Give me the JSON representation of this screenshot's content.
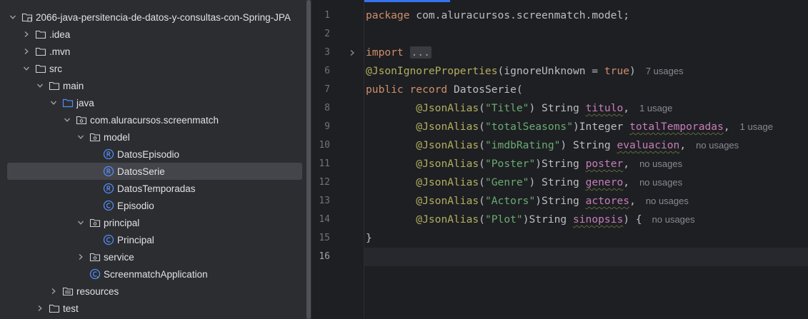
{
  "project_tree": {
    "items": [
      {
        "label": "2066-java-persitencia-de-datos-y-consultas-con-Spring-JPA",
        "icon": "module-folder-icon",
        "expanded": true
      },
      {
        "label": ".idea",
        "icon": "folder-icon",
        "expanded": false
      },
      {
        "label": ".mvn",
        "icon": "folder-icon",
        "expanded": false
      },
      {
        "label": "src",
        "icon": "folder-icon",
        "expanded": true
      },
      {
        "label": "main",
        "icon": "folder-icon",
        "expanded": true
      },
      {
        "label": "java",
        "icon": "source-folder-icon",
        "expanded": true
      },
      {
        "label": "com.aluracursos.screenmatch",
        "icon": "package-icon",
        "expanded": true
      },
      {
        "label": "model",
        "icon": "package-icon",
        "expanded": true
      },
      {
        "label": "DatosEpisodio",
        "icon": "record-icon"
      },
      {
        "label": "DatosSerie",
        "icon": "record-icon",
        "selected": true
      },
      {
        "label": "DatosTemporadas",
        "icon": "record-icon"
      },
      {
        "label": "Episodio",
        "icon": "class-icon"
      },
      {
        "label": "principal",
        "icon": "package-icon",
        "expanded": true
      },
      {
        "label": "Principal",
        "icon": "class-icon"
      },
      {
        "label": "service",
        "icon": "package-icon",
        "expanded": false
      },
      {
        "label": "ScreenmatchApplication",
        "icon": "spring-app-icon"
      },
      {
        "label": "resources",
        "icon": "resources-folder-icon",
        "expanded": false
      },
      {
        "label": "test",
        "icon": "folder-icon",
        "expanded": false
      }
    ]
  },
  "editor": {
    "line_numbers": [
      "1",
      "2",
      "3",
      "6",
      "7",
      "8",
      "9",
      "10",
      "11",
      "12",
      "13",
      "14",
      "15",
      "16"
    ],
    "current_line": "16",
    "code": {
      "l1_kw": "package",
      "l1_rest": " com.aluracursos.screenmatch.model;",
      "l3_kw": "import",
      "l3_fold": "...",
      "l6_ann": "@JsonIgnoreProperties",
      "l6_open": "(ignoreUnknown = ",
      "l6_kw": "true",
      "l6_close": ")",
      "l6_hint": "7 usages",
      "l7_kw": "public record",
      "l7_rest": " DatosSerie(",
      "l8_indent": "        ",
      "l8_ann": "@JsonAlias",
      "l8_p1": "(",
      "l8_str": "\"Title\"",
      "l8_p2": ") String ",
      "l8_fld": "titulo",
      "l8_end": ",",
      "l8_hint": "1 usage",
      "l9_ann": "@JsonAlias",
      "l9_str": "\"totalSeasons\"",
      "l9_p2": ")Integer ",
      "l9_fld": "totalTemporadas",
      "l9_end": ",",
      "l9_hint": "1 usage",
      "l10_ann": "@JsonAlias",
      "l10_str": "\"imdbRating\"",
      "l10_p2": ") String ",
      "l10_fld": "evaluacion",
      "l10_end": ",",
      "l10_hint": "no usages",
      "l11_ann": "@JsonAlias",
      "l11_str": "\"Poster\"",
      "l11_p2": ")String ",
      "l11_fld": "poster",
      "l11_end": ",",
      "l11_hint": "no usages",
      "l12_ann": "@JsonAlias",
      "l12_str": "\"Genre\"",
      "l12_p2": ") String ",
      "l12_fld": "genero",
      "l12_end": ",",
      "l12_hint": "no usages",
      "l13_ann": "@JsonAlias",
      "l13_str": "\"Actors\"",
      "l13_p2": ")String ",
      "l13_fld": "actores",
      "l13_end": ",",
      "l13_hint": "no usages",
      "l14_ann": "@JsonAlias",
      "l14_str": "\"Plot\"",
      "l14_p2": ")String ",
      "l14_fld": "sinopsis",
      "l14_end": ") {",
      "l14_hint": "no usages",
      "l15": "}",
      "paren": "("
    }
  },
  "colors": {
    "keyword": "#cf8e6d",
    "annotation": "#b3ae60",
    "string": "#6aab73",
    "field": "#c77dbb",
    "text": "#bcbec4",
    "selection": "#43454a",
    "accent": "#3574f0"
  }
}
